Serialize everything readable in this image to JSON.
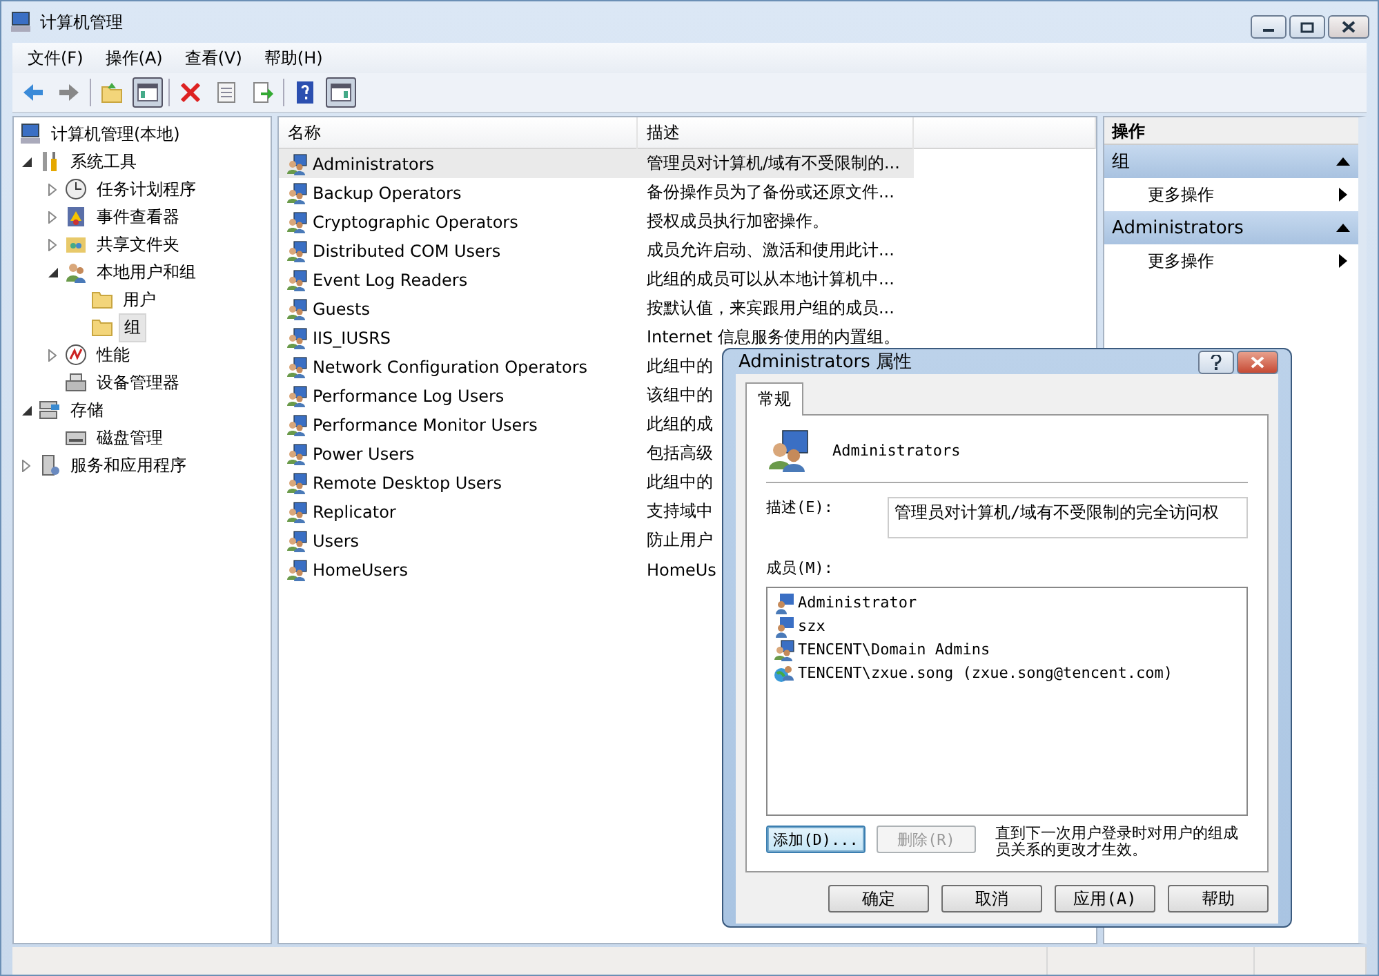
{
  "window": {
    "title": "计算机管理"
  },
  "menu": [
    "文件(F)",
    "操作(A)",
    "查看(V)",
    "帮助(H)"
  ],
  "toolbar": [
    {
      "kind": "back",
      "pressed": false
    },
    {
      "kind": "forward",
      "pressed": false
    },
    {
      "kind": "sep"
    },
    {
      "kind": "up",
      "pressed": false
    },
    {
      "kind": "tree",
      "pressed": true
    },
    {
      "kind": "sep"
    },
    {
      "kind": "delete",
      "pressed": false
    },
    {
      "kind": "properties",
      "pressed": false
    },
    {
      "kind": "export",
      "pressed": false
    },
    {
      "kind": "sep"
    },
    {
      "kind": "help",
      "pressed": false
    },
    {
      "kind": "pane",
      "pressed": true
    }
  ],
  "tree": [
    {
      "label": "计算机管理(本地)",
      "kind": "computer",
      "selected": false,
      "children": [
        {
          "label": "系统工具",
          "kind": "tools",
          "expanded": true,
          "selected": false,
          "children": [
            {
              "label": "任务计划程序",
              "kind": "clock",
              "expanded": false,
              "selected": false
            },
            {
              "label": "事件查看器",
              "kind": "event",
              "expanded": false,
              "selected": false
            },
            {
              "label": "共享文件夹",
              "kind": "share",
              "expanded": false,
              "selected": false
            },
            {
              "label": "本地用户和组",
              "kind": "users",
              "expanded": true,
              "selected": false,
              "children": [
                {
                  "label": "用户",
                  "kind": "folder",
                  "selected": false
                },
                {
                  "label": "组",
                  "kind": "folder",
                  "selected": true
                }
              ]
            },
            {
              "label": "性能",
              "kind": "perf",
              "expanded": false,
              "selected": false
            },
            {
              "label": "设备管理器",
              "kind": "device",
              "selected": false
            }
          ]
        },
        {
          "label": "存储",
          "kind": "storage",
          "expanded": true,
          "selected": false,
          "children": [
            {
              "label": "磁盘管理",
              "kind": "disk",
              "selected": false
            }
          ]
        },
        {
          "label": "服务和应用程序",
          "kind": "services",
          "expanded": false,
          "selected": false
        }
      ]
    }
  ],
  "table": {
    "columns": [
      "名称",
      "描述"
    ],
    "rows": [
      {
        "name": "Administrators",
        "description": "管理员对计算机/域有不受限制的...",
        "selected": true
      },
      {
        "name": "Backup Operators",
        "description": "备份操作员为了备份或还原文件...",
        "selected": false
      },
      {
        "name": "Cryptographic Operators",
        "description": "授权成员执行加密操作。",
        "selected": false
      },
      {
        "name": "Distributed COM Users",
        "description": "成员允许启动、激活和使用此计...",
        "selected": false
      },
      {
        "name": "Event Log Readers",
        "description": "此组的成员可以从本地计算机中...",
        "selected": false
      },
      {
        "name": "Guests",
        "description": "按默认值，来宾跟用户组的成员...",
        "selected": false
      },
      {
        "name": "IIS_IUSRS",
        "description": "Internet 信息服务使用的内置组。",
        "selected": false
      },
      {
        "name": "Network Configuration Operators",
        "description": "此组中的",
        "selected": false
      },
      {
        "name": "Performance Log Users",
        "description": "该组中的",
        "selected": false
      },
      {
        "name": "Performance Monitor Users",
        "description": "此组的成",
        "selected": false
      },
      {
        "name": "Power Users",
        "description": "包括高级",
        "selected": false
      },
      {
        "name": "Remote Desktop Users",
        "description": "此组中的",
        "selected": false
      },
      {
        "name": "Replicator",
        "description": "支持域中",
        "selected": false
      },
      {
        "name": "Users",
        "description": "防止用户",
        "selected": false
      },
      {
        "name": "HomeUsers",
        "description": "HomeUs",
        "selected": false
      }
    ]
  },
  "actions": {
    "title": "操作",
    "sections": [
      {
        "title": "组",
        "expanded": true,
        "items": [
          "更多操作"
        ]
      },
      {
        "title": "Administrators",
        "expanded": true,
        "items": [
          "更多操作"
        ]
      }
    ]
  },
  "dialog": {
    "title": "Administrators 属性",
    "tabs": [
      {
        "label": "常规",
        "selected": true
      }
    ],
    "group_name": "Administrators",
    "description_label": "描述(E):",
    "description": "管理员对计算机/域有不受限制的完全访问权",
    "members_label": "成员(M):",
    "members": [
      {
        "name": "Administrator",
        "kind": "user"
      },
      {
        "name": "szx",
        "kind": "user"
      },
      {
        "name": "TENCENT\\Domain Admins",
        "kind": "group"
      },
      {
        "name": "TENCENT\\zxue.song (zxue.song@tencent.com)",
        "kind": "domain-user"
      }
    ],
    "add_button": {
      "label": "添加(D)...",
      "disabled": false,
      "focused": true
    },
    "remove_button": {
      "label": "删除(R)",
      "disabled": true,
      "focused": false
    },
    "note": "直到下一次用户登录时对用户的组成员关系的更改才生效。",
    "buttons": [
      "确定",
      "取消",
      "应用(A)",
      "帮助"
    ]
  }
}
